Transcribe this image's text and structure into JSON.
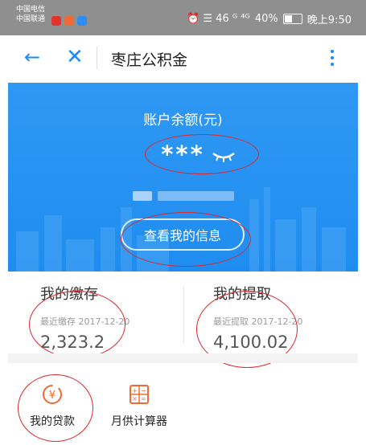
{
  "status_bar": {
    "carrier_1": "中国电信",
    "carrier_2": "中国联通",
    "right_text": "⏰ ☰ 46 ᴳ ⁴ᴳ",
    "battery": "40%",
    "time": "晚上9:50"
  },
  "nav": {
    "title": "枣庄公积金",
    "back_icon": "←",
    "close_icon": "✕"
  },
  "banner": {
    "label": "账户余额(元)",
    "value": "***",
    "button": "查看我的信息"
  },
  "stats": {
    "deposit": {
      "title": "我的缴存",
      "date": "最近缴存 2017-12-20",
      "value": "2,323.2"
    },
    "withdraw": {
      "title": "我的提取",
      "date": "最近提取 2017-12-20",
      "value": "4,100.02"
    }
  },
  "tools": [
    {
      "label": "我的贷款",
      "icon": "loan-icon"
    },
    {
      "label": "月供计算器",
      "icon": "calculator-icon"
    }
  ],
  "colors": {
    "accent": "#1a8cff",
    "banner": "#2590f2",
    "annotation": "#e0262a",
    "icon_orange": "#f06a35"
  }
}
